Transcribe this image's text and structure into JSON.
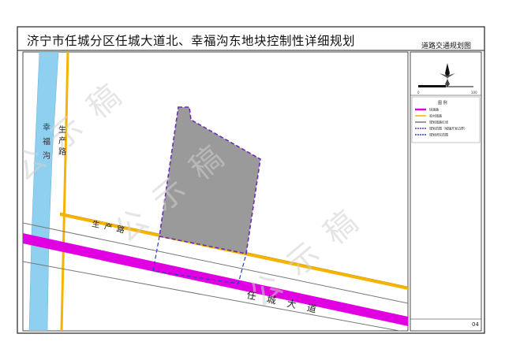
{
  "map": {
    "title": "济宁市任城分区任城大道北、幸福沟东地块控制性详细规划",
    "subtitle": "道路交通规划图",
    "page_number": "04",
    "watermark": "公示稿",
    "roads": {
      "river_label": "幸福沟",
      "shengchan_vertical": "生产路",
      "shengchan_horizontal": "生产路",
      "rencheng_avenue": "任城大道"
    },
    "scale_bar": {
      "labels": [
        "0",
        "100"
      ]
    },
    "legend": {
      "title": "图  例",
      "items": [
        {
          "label": "快速路",
          "color": "#e100e1"
        },
        {
          "label": "农村道路",
          "color": "#f5b400"
        },
        {
          "label": "规划道路红线",
          "color": "#777777"
        },
        {
          "label": "规划范围（城镇开发边界）",
          "color": "#6a2fb0"
        },
        {
          "label": "规划研究范围",
          "color": "#2d3fb6"
        }
      ]
    },
    "colors": {
      "expressway": "#e100e1",
      "rural_road": "#f5b400",
      "river": "#8fd0f0",
      "parcel": "#9a9a9a",
      "boundary": "#6a2fb0",
      "study_boundary": "#2d3fb6"
    }
  }
}
